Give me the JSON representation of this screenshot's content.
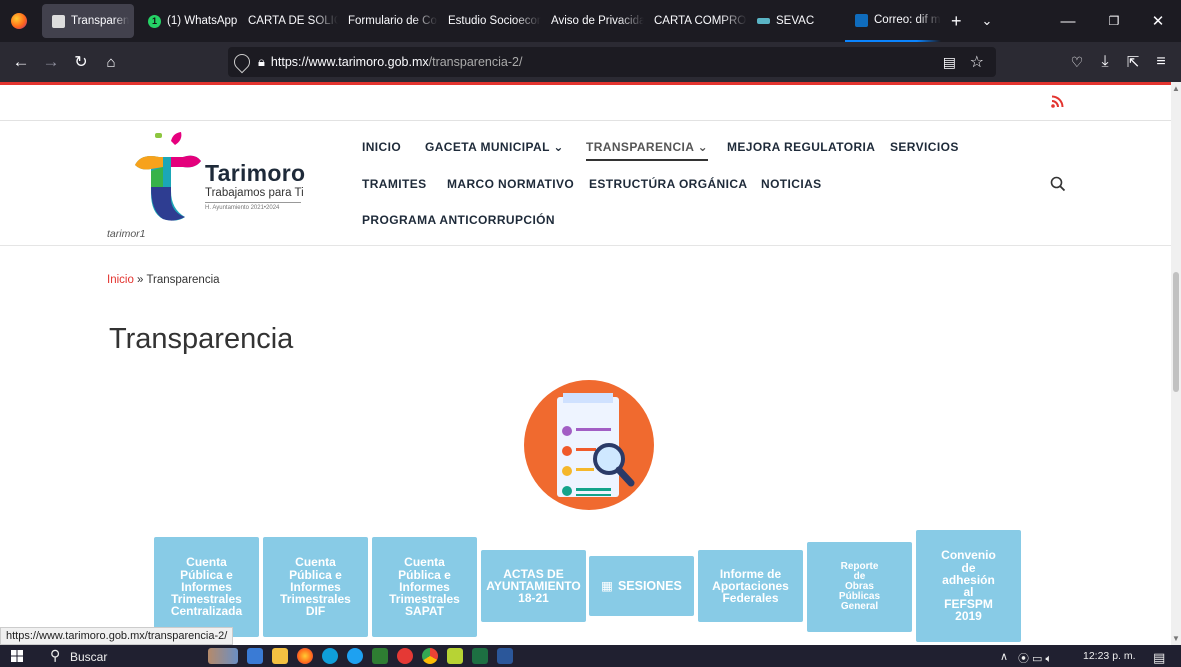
{
  "browser": {
    "tabs": [
      {
        "label": "Transparen",
        "active": true
      },
      {
        "label": "(1) WhatsApp"
      },
      {
        "label": "CARTA DE SOLICIT"
      },
      {
        "label": "Formulario de Co"
      },
      {
        "label": "Estudio Socioecon"
      },
      {
        "label": "Aviso de Privacida"
      },
      {
        "label": "CARTA COMPROM"
      },
      {
        "label": "SEVAC"
      },
      {
        "label": "Correo: dif mu"
      }
    ],
    "whatsapp_badge": "1",
    "url_host": "https://www.tarimoro.gob.mx",
    "url_path": "/transparencia-2/",
    "status_url": "https://www.tarimoro.gob.mx/transparencia-2/"
  },
  "site": {
    "logo_title": "Tarimoro",
    "logo_subtitle": "Trabajamos para Ti",
    "logo_admin": "H. Ayuntamiento 2021•2024",
    "site_name": "tarimor1",
    "menu": {
      "inicio": "INICIO",
      "gaceta": "GACETA MUNICIPAL ⌄",
      "transparencia": "TRANSPARENCIA ⌄",
      "mejora": "MEJORA REGULATORIA",
      "servicios": "SERVICIOS",
      "tramites": "TRAMITES",
      "marco": "MARCO NORMATIVO",
      "estructura": "ESTRUCTÚRA ORGÁNICA",
      "noticias": "NOTICIAS",
      "programa": "PROGRAMA ANTICORRUPCIÓN"
    },
    "breadcrumb": {
      "home": "Inicio",
      "sep": " » ",
      "current": "Transparencia"
    },
    "page_title": "Transparencia",
    "tiles": {
      "t1": [
        "Cuenta",
        "Pública e",
        "Informes",
        "Trimestrales",
        "Centralizada"
      ],
      "t2": [
        "Cuenta",
        "Pública e",
        "Informes",
        "Trimestrales",
        "DIF"
      ],
      "t3": [
        "Cuenta",
        "Pública e",
        "Informes",
        "Trimestrales",
        "SAPAT"
      ],
      "t4": [
        "ACTAS DE",
        "AYUNTAMIENTO",
        "18-21"
      ],
      "t5": "SESIONES",
      "t6": [
        "Informe de",
        "Aportaciones",
        "Federales"
      ],
      "t7": [
        "Reporte",
        "de",
        "Obras",
        "Públicas",
        "General"
      ],
      "t8": [
        "Convenio",
        "de",
        "adhesión",
        "al",
        "FEFSPM",
        "2019"
      ]
    },
    "accent_color": "#e3342f",
    "tile_color": "#88cbe6"
  },
  "taskbar": {
    "search_label": "Buscar",
    "clock": "12:23 p. m."
  }
}
